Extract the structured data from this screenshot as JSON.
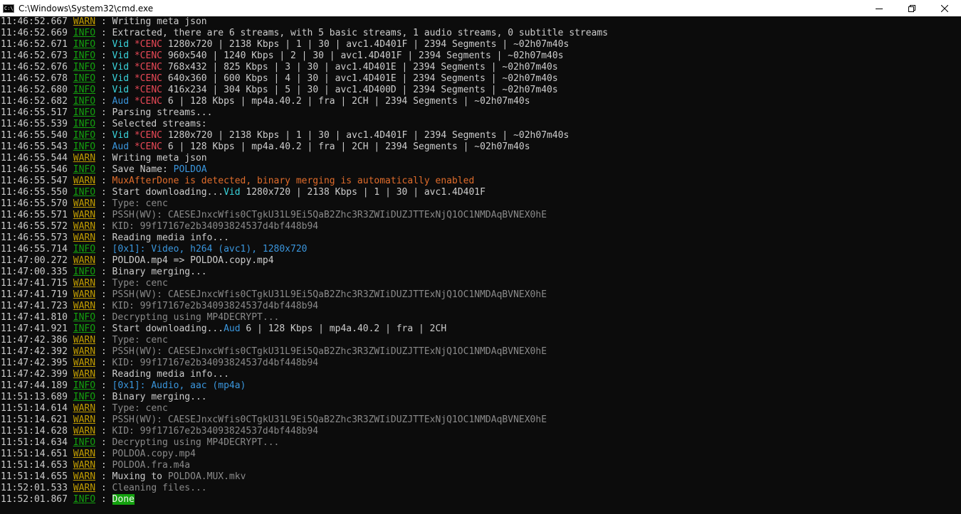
{
  "window": {
    "title": "C:\\Windows\\System32\\cmd.exe",
    "icon_text": "C:\\",
    "icon": "console-app-icon",
    "controls": [
      "minimize-icon",
      "restore-icon",
      "close-icon"
    ]
  },
  "colors": {
    "background": "#0c0c0c",
    "info_level": "#13a10e",
    "warn_level": "#c19c00",
    "blue": "#3a96dd",
    "cyan": "#3ad5dd",
    "red": "#e74856",
    "orange": "#e06c2b",
    "gray": "#8a8a8a"
  },
  "console": {
    "lines": [
      {
        "time": "11:46:52.667",
        "level": "WARN",
        "segments": [
          {
            "t": "Writing meta json",
            "c": "default"
          }
        ]
      },
      {
        "time": "11:46:52.669",
        "level": "INFO",
        "segments": [
          {
            "t": "Extracted, there are 6 streams, with 5 basic streams, 1 audio streams, 0 subtitle streams",
            "c": "default"
          }
        ]
      },
      {
        "time": "11:46:52.671",
        "level": "INFO",
        "segments": [
          {
            "t": "Vid ",
            "c": "cyan"
          },
          {
            "t": "*CENC ",
            "c": "red"
          },
          {
            "t": "1280x720 | 2138 Kbps | 1 | 30 | avc1.4D401F | 2394 Segments | ~02h07m40s",
            "c": "default"
          }
        ]
      },
      {
        "time": "11:46:52.673",
        "level": "INFO",
        "segments": [
          {
            "t": "Vid ",
            "c": "cyan"
          },
          {
            "t": "*CENC ",
            "c": "red"
          },
          {
            "t": "960x540 | 1240 Kbps | 2 | 30 | avc1.4D401F | 2394 Segments | ~02h07m40s",
            "c": "default"
          }
        ]
      },
      {
        "time": "11:46:52.676",
        "level": "INFO",
        "segments": [
          {
            "t": "Vid ",
            "c": "cyan"
          },
          {
            "t": "*CENC ",
            "c": "red"
          },
          {
            "t": "768x432 | 825 Kbps | 3 | 30 | avc1.4D401E | 2394 Segments | ~02h07m40s",
            "c": "default"
          }
        ]
      },
      {
        "time": "11:46:52.678",
        "level": "INFO",
        "segments": [
          {
            "t": "Vid ",
            "c": "cyan"
          },
          {
            "t": "*CENC ",
            "c": "red"
          },
          {
            "t": "640x360 | 600 Kbps | 4 | 30 | avc1.4D401E | 2394 Segments | ~02h07m40s",
            "c": "default"
          }
        ]
      },
      {
        "time": "11:46:52.680",
        "level": "INFO",
        "segments": [
          {
            "t": "Vid ",
            "c": "cyan"
          },
          {
            "t": "*CENC ",
            "c": "red"
          },
          {
            "t": "416x234 | 304 Kbps | 5 | 30 | avc1.4D400D | 2394 Segments | ~02h07m40s",
            "c": "default"
          }
        ]
      },
      {
        "time": "11:46:52.682",
        "level": "INFO",
        "segments": [
          {
            "t": "Aud ",
            "c": "blue"
          },
          {
            "t": "*CENC ",
            "c": "red"
          },
          {
            "t": "6 | 128 Kbps | mp4a.40.2 | fra | 2CH | 2394 Segments | ~02h07m40s",
            "c": "default"
          }
        ]
      },
      {
        "time": "11:46:55.517",
        "level": "INFO",
        "segments": [
          {
            "t": "Parsing streams...",
            "c": "default"
          }
        ]
      },
      {
        "time": "11:46:55.539",
        "level": "INFO",
        "segments": [
          {
            "t": "Selected streams:",
            "c": "default"
          }
        ]
      },
      {
        "time": "11:46:55.540",
        "level": "INFO",
        "segments": [
          {
            "t": "Vid ",
            "c": "cyan"
          },
          {
            "t": "*CENC ",
            "c": "red"
          },
          {
            "t": "1280x720 | 2138 Kbps | 1 | 30 | avc1.4D401F | 2394 Segments | ~02h07m40s",
            "c": "default"
          }
        ]
      },
      {
        "time": "11:46:55.543",
        "level": "INFO",
        "segments": [
          {
            "t": "Aud ",
            "c": "blue"
          },
          {
            "t": "*CENC ",
            "c": "red"
          },
          {
            "t": "6 | 128 Kbps | mp4a.40.2 | fra | 2CH | 2394 Segments | ~02h07m40s",
            "c": "default"
          }
        ]
      },
      {
        "time": "11:46:55.544",
        "level": "WARN",
        "segments": [
          {
            "t": "Writing meta json",
            "c": "default"
          }
        ]
      },
      {
        "time": "11:46:55.546",
        "level": "INFO",
        "segments": [
          {
            "t": "Save Name: ",
            "c": "default"
          },
          {
            "t": "POLDOA",
            "c": "blue"
          }
        ]
      },
      {
        "time": "11:46:55.547",
        "level": "WARN",
        "segments": [
          {
            "t": "MuxAfterDone is detected, binary merging is automatically enabled",
            "c": "orange"
          }
        ]
      },
      {
        "time": "11:46:55.550",
        "level": "INFO",
        "segments": [
          {
            "t": "Start downloading...",
            "c": "default"
          },
          {
            "t": "Vid ",
            "c": "cyan"
          },
          {
            "t": "1280x720 | 2138 Kbps | 1 | 30 | avc1.4D401F",
            "c": "default"
          }
        ]
      },
      {
        "time": "11:46:55.570",
        "level": "WARN",
        "segments": [
          {
            "t": "Type: cenc",
            "c": "gray"
          }
        ]
      },
      {
        "time": "11:46:55.571",
        "level": "WARN",
        "segments": [
          {
            "t": "PSSH(WV): CAESEJnxcWfis0CTgkU31L9Ei5QaB2Zhc3R3ZWIiDUZJTTExNjQ1OC1NMDAqBVNEX0hE",
            "c": "gray"
          }
        ]
      },
      {
        "time": "11:46:55.572",
        "level": "WARN",
        "segments": [
          {
            "t": "KID: 99f17167e2b34093824537d4bf448b94",
            "c": "gray"
          }
        ]
      },
      {
        "time": "11:46:55.573",
        "level": "WARN",
        "segments": [
          {
            "t": "Reading media info...",
            "c": "default"
          }
        ]
      },
      {
        "time": "11:46:55.714",
        "level": "INFO",
        "segments": [
          {
            "t": "[0x1]: Video, h264 (avc1), 1280x720",
            "c": "blue"
          }
        ]
      },
      {
        "time": "11:47:00.272",
        "level": "WARN",
        "segments": [
          {
            "t": "POLDOA.mp4 => POLDOA.copy.mp4",
            "c": "default"
          }
        ]
      },
      {
        "time": "11:47:00.335",
        "level": "INFO",
        "segments": [
          {
            "t": "Binary merging...",
            "c": "default"
          }
        ]
      },
      {
        "time": "11:47:41.715",
        "level": "WARN",
        "segments": [
          {
            "t": "Type: cenc",
            "c": "gray"
          }
        ]
      },
      {
        "time": "11:47:41.719",
        "level": "WARN",
        "segments": [
          {
            "t": "PSSH(WV): CAESEJnxcWfis0CTgkU31L9Ei5QaB2Zhc3R3ZWIiDUZJTTExNjQ1OC1NMDAqBVNEX0hE",
            "c": "gray"
          }
        ]
      },
      {
        "time": "11:47:41.723",
        "level": "WARN",
        "segments": [
          {
            "t": "KID: 99f17167e2b34093824537d4bf448b94",
            "c": "gray"
          }
        ]
      },
      {
        "time": "11:47:41.810",
        "level": "INFO",
        "segments": [
          {
            "t": "Decrypting using MP4DECRYPT...",
            "c": "gray"
          }
        ]
      },
      {
        "time": "11:47:41.921",
        "level": "INFO",
        "segments": [
          {
            "t": "Start downloading...",
            "c": "default"
          },
          {
            "t": "Aud ",
            "c": "blue"
          },
          {
            "t": "6 | 128 Kbps | mp4a.40.2 | fra | 2CH",
            "c": "default"
          }
        ]
      },
      {
        "time": "11:47:42.386",
        "level": "WARN",
        "segments": [
          {
            "t": "Type: cenc",
            "c": "gray"
          }
        ]
      },
      {
        "time": "11:47:42.392",
        "level": "WARN",
        "segments": [
          {
            "t": "PSSH(WV): CAESEJnxcWfis0CTgkU31L9Ei5QaB2Zhc3R3ZWIiDUZJTTExNjQ1OC1NMDAqBVNEX0hE",
            "c": "gray"
          }
        ]
      },
      {
        "time": "11:47:42.395",
        "level": "WARN",
        "segments": [
          {
            "t": "KID: 99f17167e2b34093824537d4bf448b94",
            "c": "gray"
          }
        ]
      },
      {
        "time": "11:47:42.399",
        "level": "WARN",
        "segments": [
          {
            "t": "Reading media info...",
            "c": "default"
          }
        ]
      },
      {
        "time": "11:47:44.189",
        "level": "INFO",
        "segments": [
          {
            "t": "[0x1]: Audio, aac (mp4a)",
            "c": "blue"
          }
        ]
      },
      {
        "time": "11:51:13.689",
        "level": "INFO",
        "segments": [
          {
            "t": "Binary merging...",
            "c": "default"
          }
        ]
      },
      {
        "time": "11:51:14.614",
        "level": "WARN",
        "segments": [
          {
            "t": "Type: cenc",
            "c": "gray"
          }
        ]
      },
      {
        "time": "11:51:14.621",
        "level": "WARN",
        "segments": [
          {
            "t": "PSSH(WV): CAESEJnxcWfis0CTgkU31L9Ei5QaB2Zhc3R3ZWIiDUZJTTExNjQ1OC1NMDAqBVNEX0hE",
            "c": "gray"
          }
        ]
      },
      {
        "time": "11:51:14.628",
        "level": "WARN",
        "segments": [
          {
            "t": "KID: 99f17167e2b34093824537d4bf448b94",
            "c": "gray"
          }
        ]
      },
      {
        "time": "11:51:14.634",
        "level": "INFO",
        "segments": [
          {
            "t": "Decrypting using MP4DECRYPT...",
            "c": "gray"
          }
        ]
      },
      {
        "time": "11:51:14.651",
        "level": "WARN",
        "segments": [
          {
            "t": "POLDOA.copy.mp4",
            "c": "gray"
          }
        ]
      },
      {
        "time": "11:51:14.653",
        "level": "WARN",
        "segments": [
          {
            "t": "POLDOA.fra.m4a",
            "c": "gray"
          }
        ]
      },
      {
        "time": "11:51:14.655",
        "level": "WARN",
        "segments": [
          {
            "t": "Muxing to ",
            "c": "default"
          },
          {
            "t": "POLDOA.MUX.mkv",
            "c": "gray"
          }
        ]
      },
      {
        "time": "11:52:01.533",
        "level": "WARN",
        "segments": [
          {
            "t": "Cleaning files...",
            "c": "gray"
          }
        ]
      },
      {
        "time": "11:52:01.867",
        "level": "INFO",
        "segments": [
          {
            "t": "Done",
            "c": "done"
          }
        ]
      }
    ]
  }
}
